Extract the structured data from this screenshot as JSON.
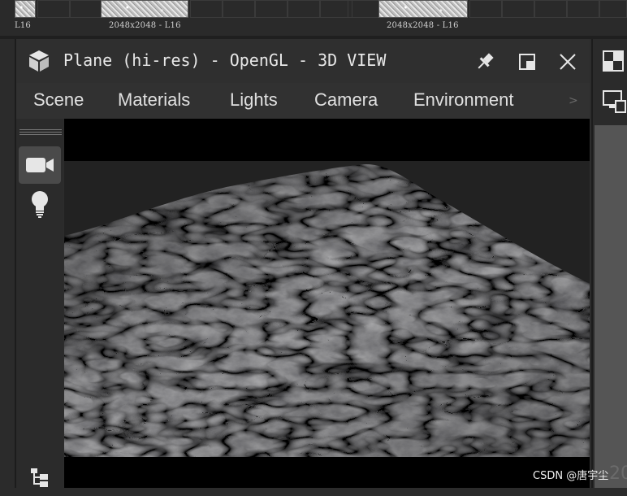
{
  "thumbnails": {
    "captions": [
      "L16",
      "2048x2048 - L16",
      "2048x2048 - L16"
    ]
  },
  "window": {
    "title": "Plane (hi-res) - OpenGL - 3D VIEW",
    "app_icon": "cube-icon",
    "controls": [
      "pin-icon",
      "maximize-icon",
      "close-icon"
    ]
  },
  "menu": {
    "items": [
      "Scene",
      "Materials",
      "Lights",
      "Camera",
      "Environment"
    ],
    "overflow": ">"
  },
  "toolbar": {
    "tools": [
      {
        "icon": "camera-icon",
        "active": true
      },
      {
        "icon": "lightbulb-icon",
        "active": false
      },
      {
        "icon": "hierarchy-icon",
        "active": false
      }
    ]
  },
  "viewport": {
    "content": "3d-rendered-plane",
    "background_color": "#000000",
    "render_bg_color": "#222222"
  },
  "right_panel": {
    "icons": [
      "checker-icon",
      "monitor-icon"
    ]
  },
  "watermark": "CSDN @唐宇尘",
  "ghost_text": "20"
}
